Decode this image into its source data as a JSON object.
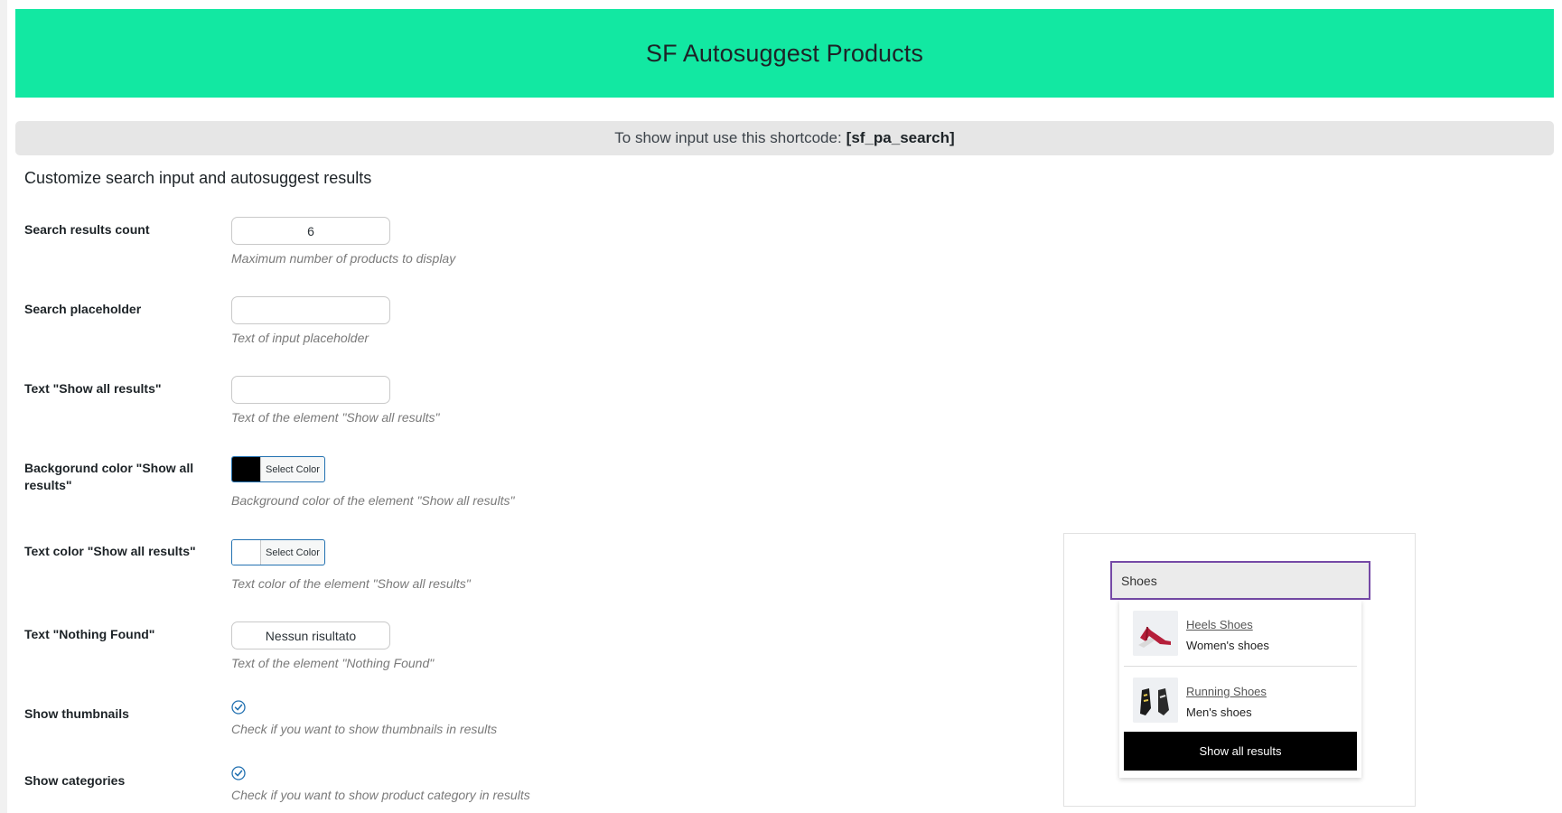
{
  "header": {
    "title": "SF Autosuggest Products"
  },
  "shortcode": {
    "text": "To show input use this shortcode:",
    "code": "[sf_pa_search]"
  },
  "section_title": "Customize search input and autosuggest results",
  "settings": {
    "results_count": {
      "label": "Search results count",
      "value": "6",
      "description": "Maximum number of products to display"
    },
    "placeholder": {
      "label": "Search placeholder",
      "value": "",
      "description": "Text of input placeholder"
    },
    "show_all_text": {
      "label": "Text \"Show all results\"",
      "value": "",
      "description": "Text of the element \"Show all results\""
    },
    "bg_color": {
      "label": "Backgorund color \"Show all results\"",
      "button": "Select Color",
      "color": "#000000",
      "description": "Background color of the element \"Show all results\""
    },
    "text_color": {
      "label": "Text color \"Show all results\"",
      "button": "Select Color",
      "color": "#ffffff",
      "description": "Text color of the element \"Show all results\""
    },
    "nothing_found": {
      "label": "Text \"Nothing Found\"",
      "value": "Nessun risultato",
      "description": "Text of the element \"Nothing Found\""
    },
    "show_thumbnails": {
      "label": "Show thumbnails",
      "checked": true,
      "description": "Check if you want to show thumbnails in results"
    },
    "show_categories": {
      "label": "Show categories",
      "checked": true,
      "description": "Check if you want to show product category in results"
    }
  },
  "preview": {
    "input_value": "Shoes",
    "results": [
      {
        "title": "Heels Shoes",
        "category": "Women's shoes",
        "thumb_icon": "heels-shoe-icon"
      },
      {
        "title": "Running Shoes",
        "category": "Men's shoes",
        "thumb_icon": "running-shoe-icon"
      }
    ],
    "show_all_label": "Show all results"
  },
  "colors": {
    "header_bg": "#12e8a2",
    "accent_border": "#7549a6",
    "checkbox": "#2271b1"
  }
}
